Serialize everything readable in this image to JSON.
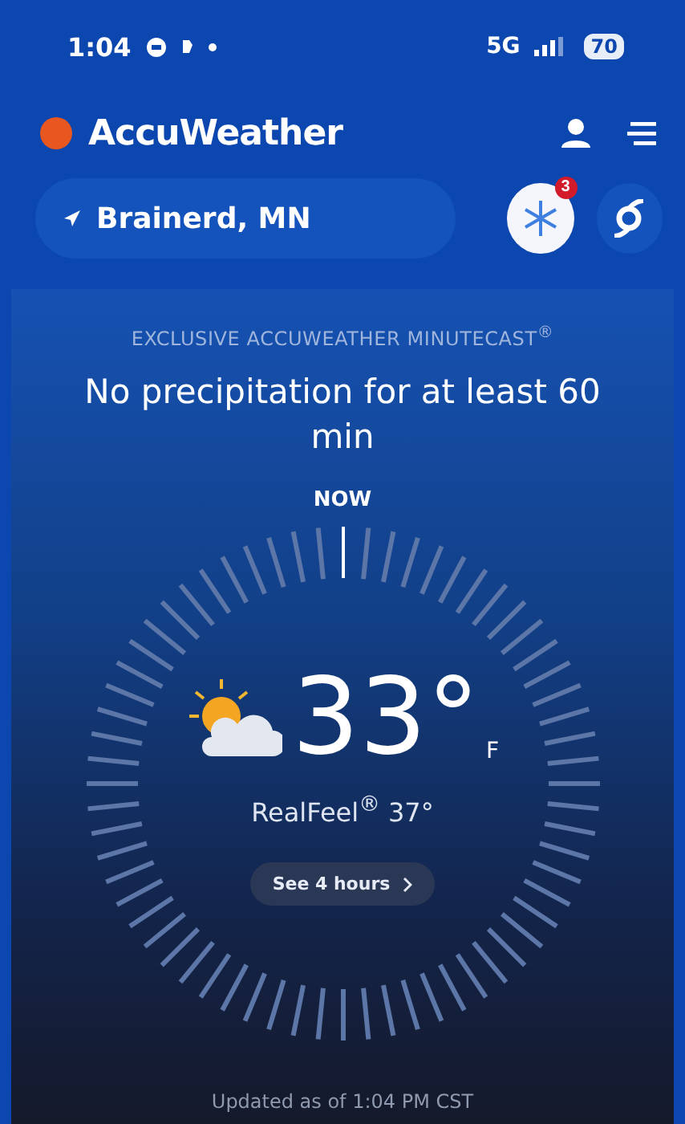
{
  "status_bar": {
    "time": "1:04",
    "network": "5G",
    "battery": "70"
  },
  "header": {
    "brand": "AccuWeather"
  },
  "location": {
    "name": "Brainerd, MN"
  },
  "alerts": {
    "badge": "3"
  },
  "minutecast": {
    "label": "EXCLUSIVE ACCUWEATHER MINUTECAST$^{®}$",
    "headline": "No precipitation for at least 60 min",
    "now": "NOW"
  },
  "current": {
    "temperature": "33°",
    "unit": "F",
    "realfeel": "RealFeel$^{®}$ 37°",
    "button": "See 4 hours",
    "updated": "Updated as of 1:04 PM CST"
  }
}
